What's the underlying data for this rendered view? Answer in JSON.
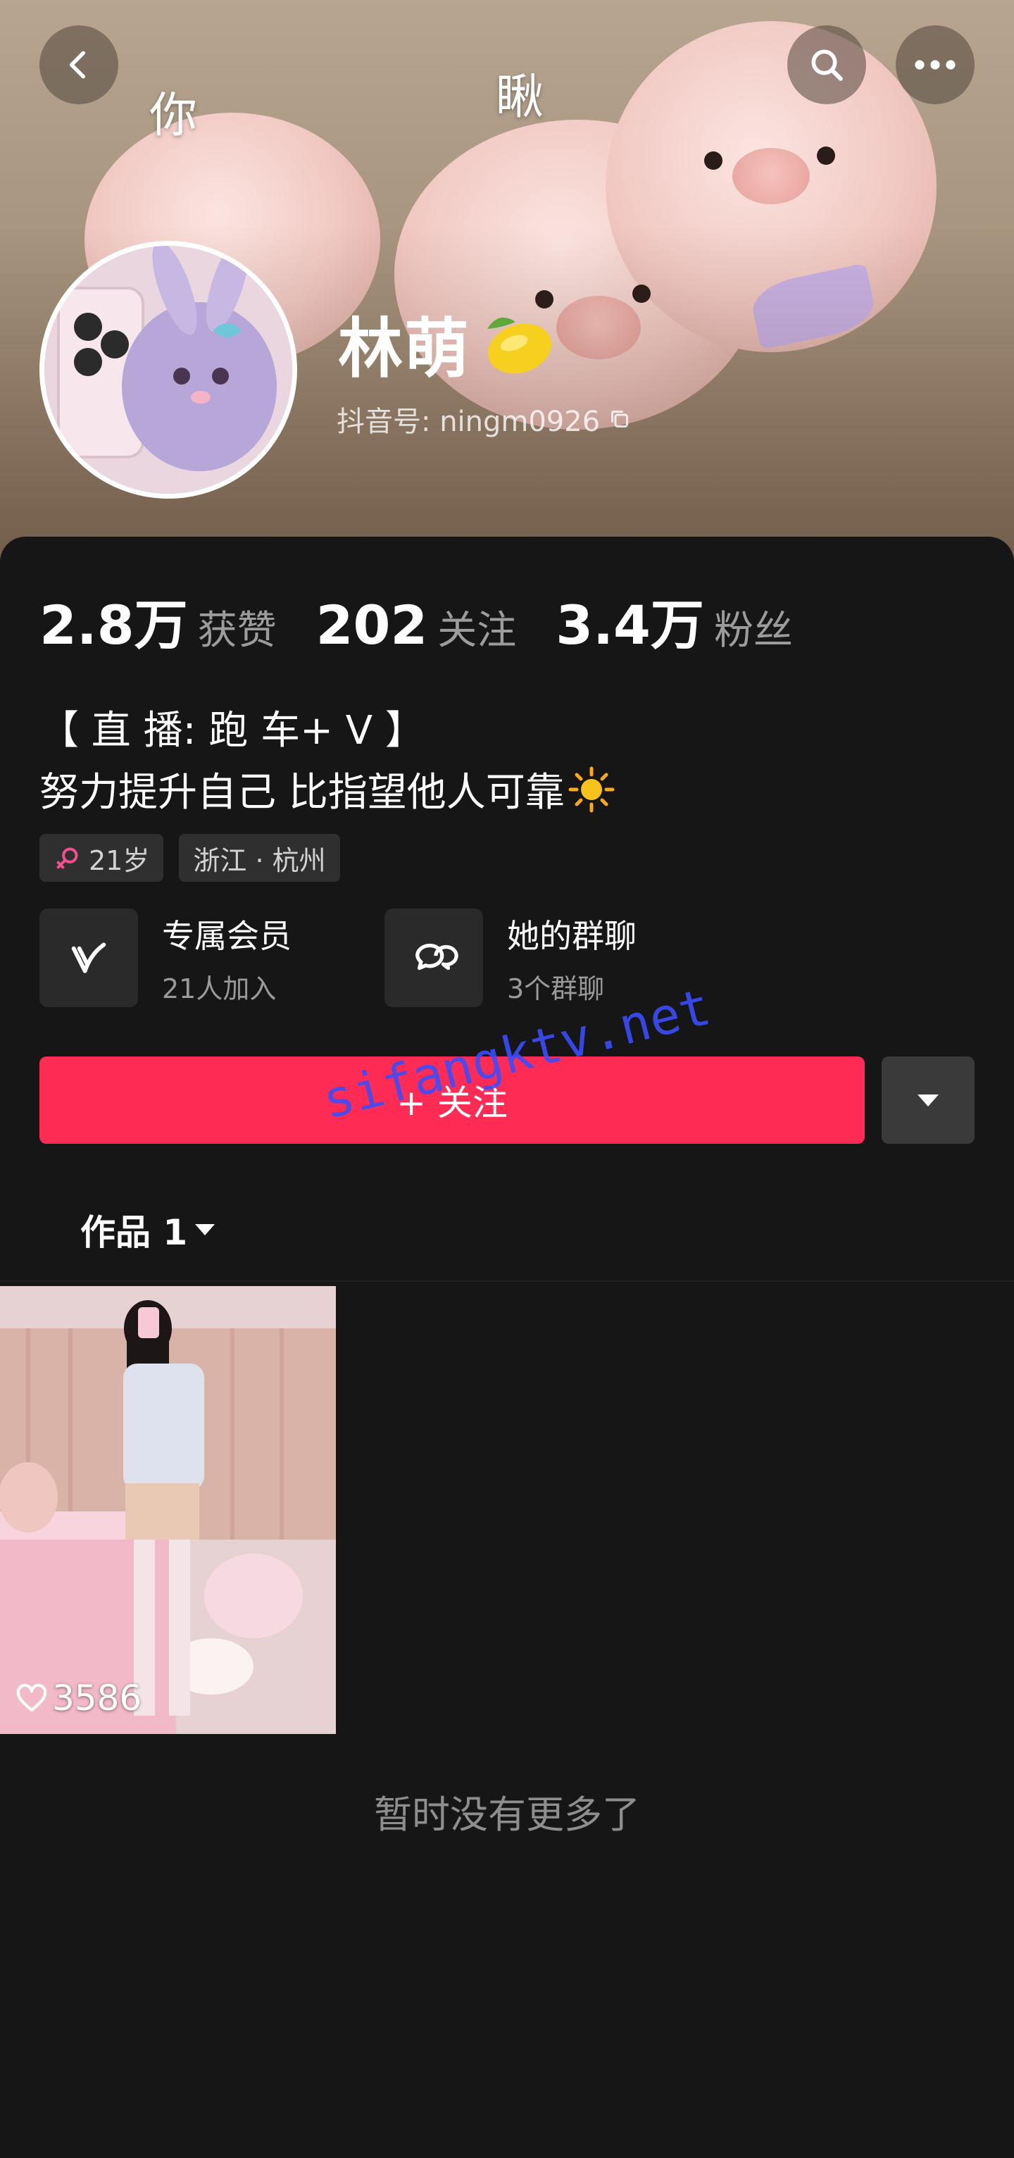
{
  "header": {
    "cover_overlay_chars": [
      "你",
      "瞅"
    ]
  },
  "profile": {
    "name": "林萌",
    "name_emoji": "lemon",
    "douyin_id": "抖音号: ningm0926"
  },
  "stats": [
    {
      "value": "2.8万",
      "label": "获赞"
    },
    {
      "value": "202",
      "label": "关注"
    },
    {
      "value": "3.4万",
      "label": "粉丝"
    }
  ],
  "bio": {
    "line1": "【 直 播: 跑 车+ V 】",
    "line2": "努力提升自己 比指望他人可靠",
    "line2_emoji": "sun"
  },
  "tags": {
    "age": "21岁",
    "location": "浙江 · 杭州"
  },
  "features": {
    "membership": {
      "title": "专属会员",
      "sub": "21人加入"
    },
    "group_chat": {
      "title": "她的群聊",
      "sub": "3个群聊"
    }
  },
  "actions": {
    "follow_label": "+ 关注"
  },
  "watermark": "sifangktv.net",
  "tabs": {
    "works_label": "作品 1"
  },
  "works": [
    {
      "likes": "3586"
    }
  ],
  "footer": {
    "no_more": "暂时没有更多了"
  },
  "colors": {
    "accent": "#fe2c55",
    "background": "#161616",
    "watermark": "#3a4dfc"
  },
  "icons": [
    "back-icon",
    "search-icon",
    "more-icon",
    "copy-icon",
    "female-icon",
    "vip-icon",
    "group-chat-icon",
    "dropdown-icon",
    "heart-icon"
  ]
}
